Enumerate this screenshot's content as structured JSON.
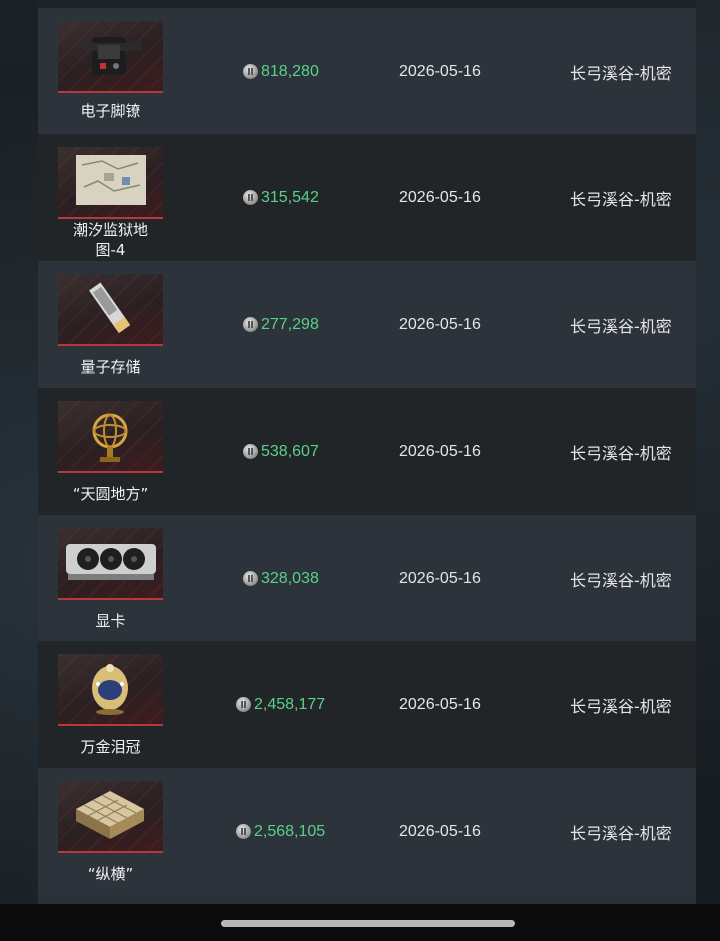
{
  "items": [
    {
      "name": "电子脚镣",
      "price": "818,280",
      "date": "2026-05-16",
      "map": "长弓溪谷-机密",
      "icon": "ankle-monitor-icon"
    },
    {
      "name": "潮汐监狱地图-4",
      "name_lines": [
        "潮汐监狱地",
        "图-4"
      ],
      "price": "315,542",
      "date": "2026-05-16",
      "map": "长弓溪谷-机密",
      "icon": "prison-map-icon"
    },
    {
      "name": "量子存储",
      "price": "277,298",
      "date": "2026-05-16",
      "map": "长弓溪谷-机密",
      "icon": "quantum-storage-icon"
    },
    {
      "name": "“天圆地方”",
      "price": "538,607",
      "date": "2026-05-16",
      "map": "长弓溪谷-机密",
      "icon": "armillary-sphere-icon"
    },
    {
      "name": "显卡",
      "price": "328,038",
      "date": "2026-05-16",
      "map": "长弓溪谷-机密",
      "icon": "graphics-card-icon"
    },
    {
      "name": "万金泪冠",
      "price": "2,458,177",
      "date": "2026-05-16",
      "map": "长弓溪谷-机密",
      "icon": "jeweled-crown-icon"
    },
    {
      "name": "“纵横”",
      "price": "2,568,105",
      "date": "2026-05-16",
      "map": "长弓溪谷-机密",
      "icon": "chessboard-icon"
    }
  ],
  "currency_icon": "silver-coin-icon",
  "colors": {
    "price": "#5bd089",
    "row_light": "#2c333b",
    "row_dark": "#222528",
    "accent_red": "#b8393d"
  }
}
